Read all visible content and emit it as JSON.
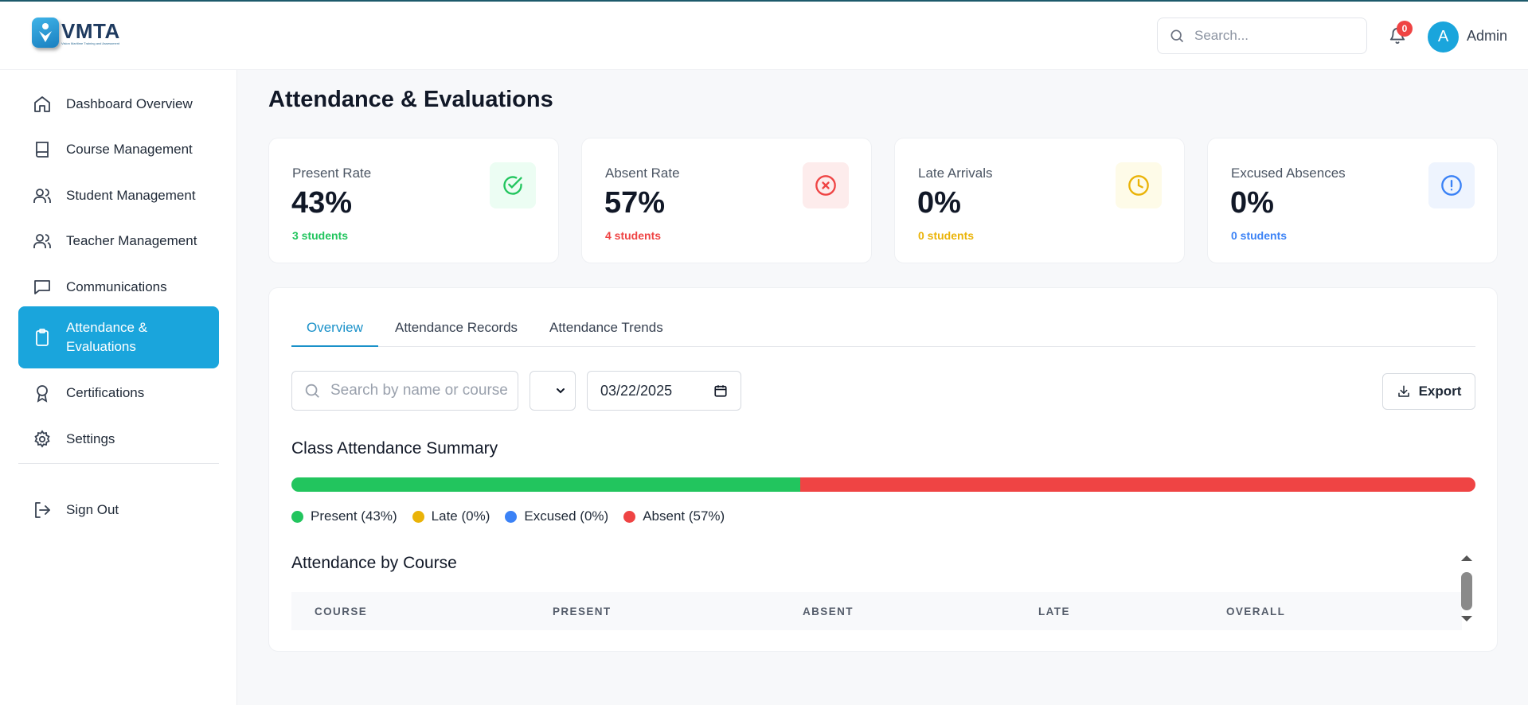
{
  "app": {
    "logo_title": "VMTA",
    "logo_tagline": "Vision Maritime Training and Assessment"
  },
  "header": {
    "search_placeholder": "Search...",
    "notification_count": "0",
    "avatar_initial": "A",
    "user_name": "Admin"
  },
  "sidebar": {
    "items": [
      {
        "label": "Dashboard Overview",
        "icon": "home-icon"
      },
      {
        "label": "Course Management",
        "icon": "book-icon"
      },
      {
        "label": "Student Management",
        "icon": "users-icon"
      },
      {
        "label": "Teacher Management",
        "icon": "users-icon"
      },
      {
        "label": "Communications",
        "icon": "message-icon"
      },
      {
        "label": "Attendance & Evaluations",
        "icon": "clipboard-icon",
        "active": true
      },
      {
        "label": "Certifications",
        "icon": "award-icon"
      },
      {
        "label": "Settings",
        "icon": "gear-icon"
      }
    ],
    "sign_out": "Sign Out"
  },
  "page": {
    "title": "Attendance & Evaluations"
  },
  "stats": [
    {
      "label": "Present Rate",
      "value": "43%",
      "sub": "3 students",
      "color": "#22c55e",
      "bg": "#ecfdf3",
      "icon": "check-circle-icon"
    },
    {
      "label": "Absent Rate",
      "value": "57%",
      "sub": "4 students",
      "color": "#ef4444",
      "bg": "#fdecec",
      "icon": "x-circle-icon"
    },
    {
      "label": "Late Arrivals",
      "value": "0%",
      "sub": "0 students",
      "color": "#eab308",
      "bg": "#fefbe8",
      "icon": "clock-icon"
    },
    {
      "label": "Excused Absences",
      "value": "0%",
      "sub": "0 students",
      "color": "#3b82f6",
      "bg": "#eef4fe",
      "icon": "alert-circle-icon"
    }
  ],
  "tabs": [
    "Overview",
    "Attendance Records",
    "Attendance Trends"
  ],
  "filters": {
    "search_placeholder": "Search by name or course",
    "date_value": "03/22/2025",
    "export_label": "Export"
  },
  "summary": {
    "title": "Class Attendance Summary",
    "segments": [
      {
        "name": "Present",
        "percent": 43,
        "color": "#22c55e"
      },
      {
        "name": "Late",
        "percent": 0,
        "color": "#eab308"
      },
      {
        "name": "Excused",
        "percent": 0,
        "color": "#3b82f6"
      },
      {
        "name": "Absent",
        "percent": 57,
        "color": "#ef4444"
      }
    ],
    "legend": [
      "Present (43%)",
      "Late (0%)",
      "Excused (0%)",
      "Absent (57%)"
    ]
  },
  "by_course": {
    "title": "Attendance by Course",
    "columns": [
      "COURSE",
      "PRESENT",
      "ABSENT",
      "LATE",
      "OVERALL"
    ]
  }
}
